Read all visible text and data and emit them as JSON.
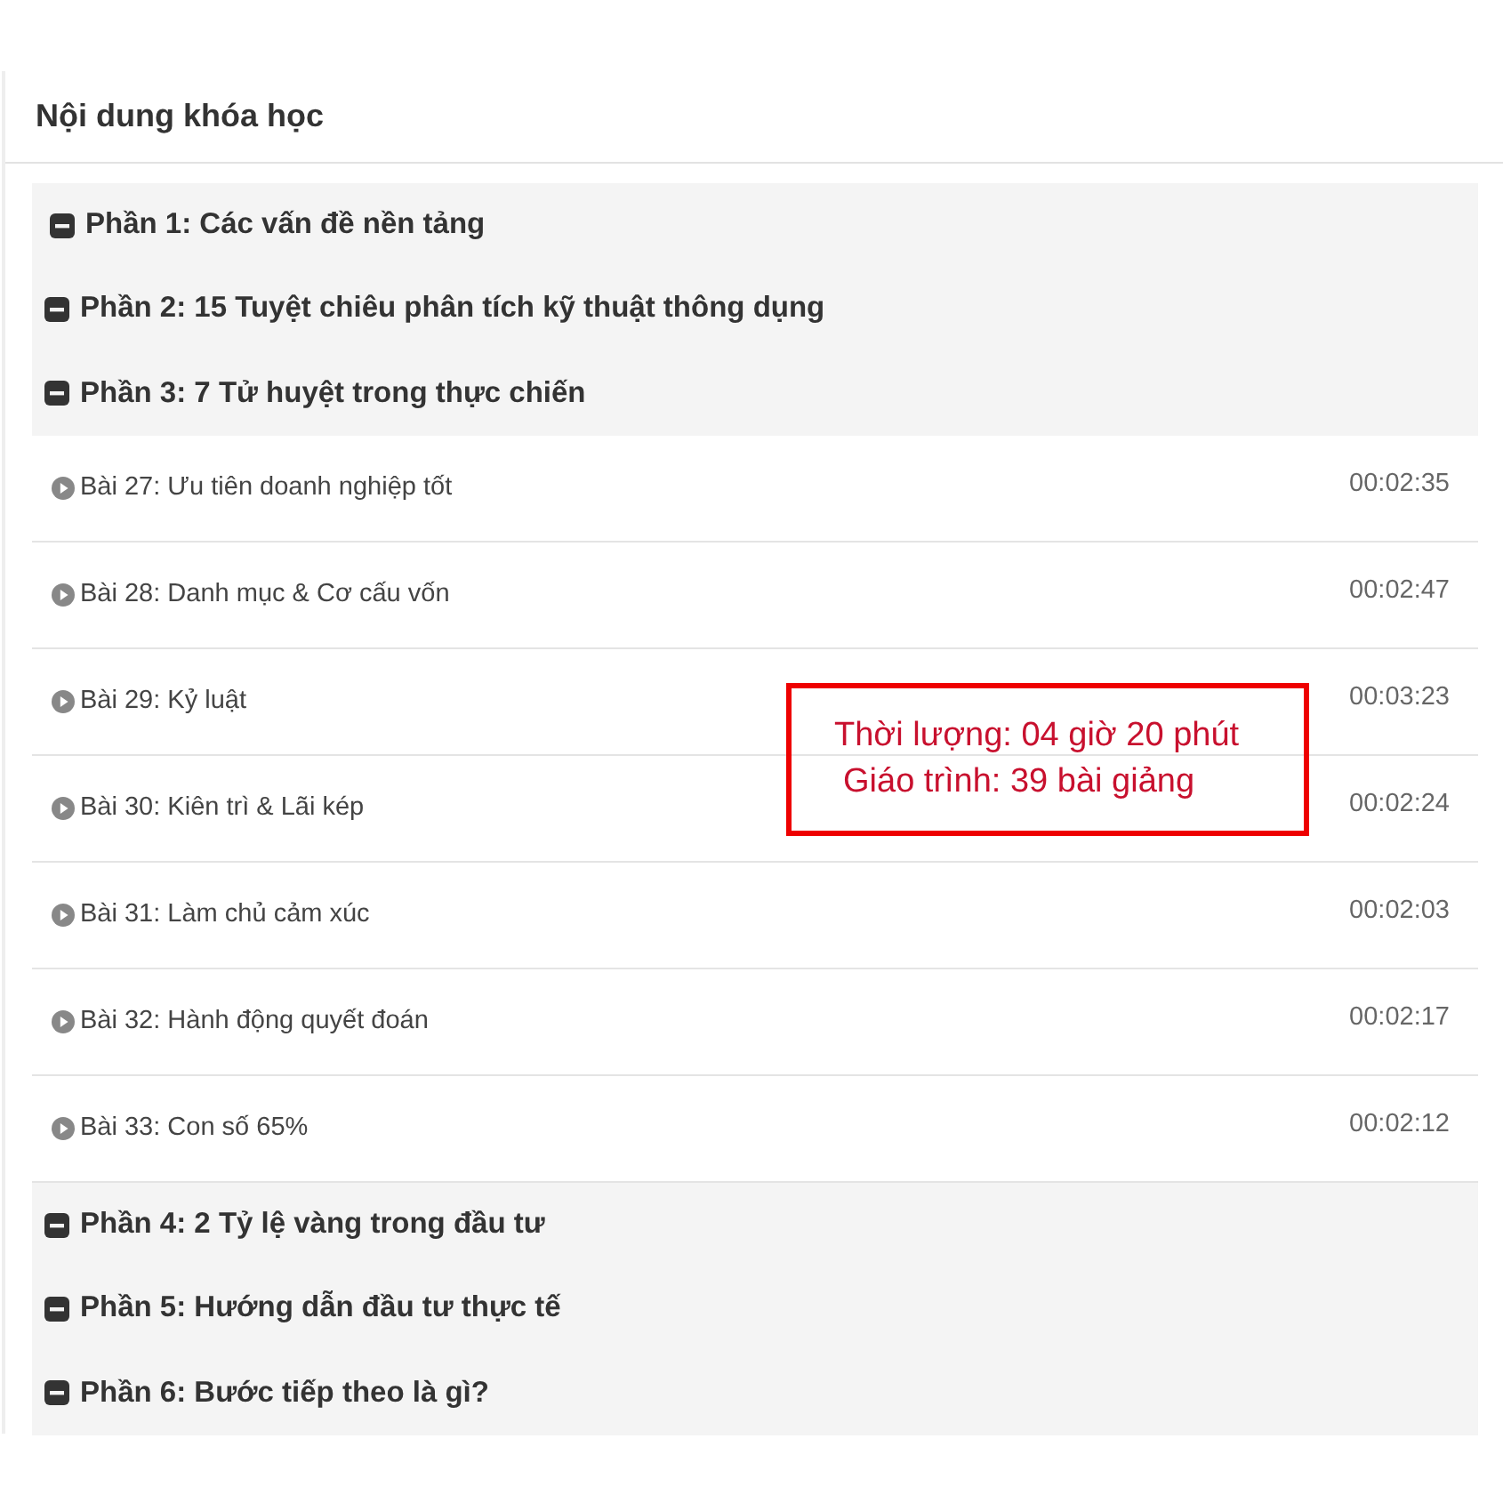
{
  "heading": "Nội dung khóa học",
  "sections": [
    {
      "title": "Phần 1: Các vấn đề nền tảng"
    },
    {
      "title": "Phần 2: 15 Tuyệt chiêu phân tích kỹ thuật thông dụng"
    },
    {
      "title": "Phần 3: 7 Tử huyệt trong thực chiến",
      "lessons": [
        {
          "title": "Bài 27: Ưu tiên doanh nghiệp tốt",
          "duration": "00:02:35"
        },
        {
          "title": "Bài 28: Danh mục & Cơ cấu vốn",
          "duration": "00:02:47"
        },
        {
          "title": "Bài 29: Kỷ luật",
          "duration": "00:03:23"
        },
        {
          "title": "Bài 30: Kiên trì & Lãi kép",
          "duration": "00:02:24"
        },
        {
          "title": "Bài 31: Làm chủ cảm xúc",
          "duration": "00:02:03"
        },
        {
          "title": "Bài 32: Hành động quyết đoán",
          "duration": "00:02:17"
        },
        {
          "title": "Bài 33: Con số 65%",
          "duration": "00:02:12"
        }
      ]
    },
    {
      "title": "Phần 4: 2 Tỷ lệ vàng trong đầu tư"
    },
    {
      "title": "Phần 5: Hướng dẫn đầu tư thực tế"
    },
    {
      "title": "Phần 6: Bước tiếp theo là gì?"
    }
  ],
  "callout": [
    "Thời lượng: 04 giờ 20 phút",
    "Giáo trình: 39 bài giảng"
  ]
}
